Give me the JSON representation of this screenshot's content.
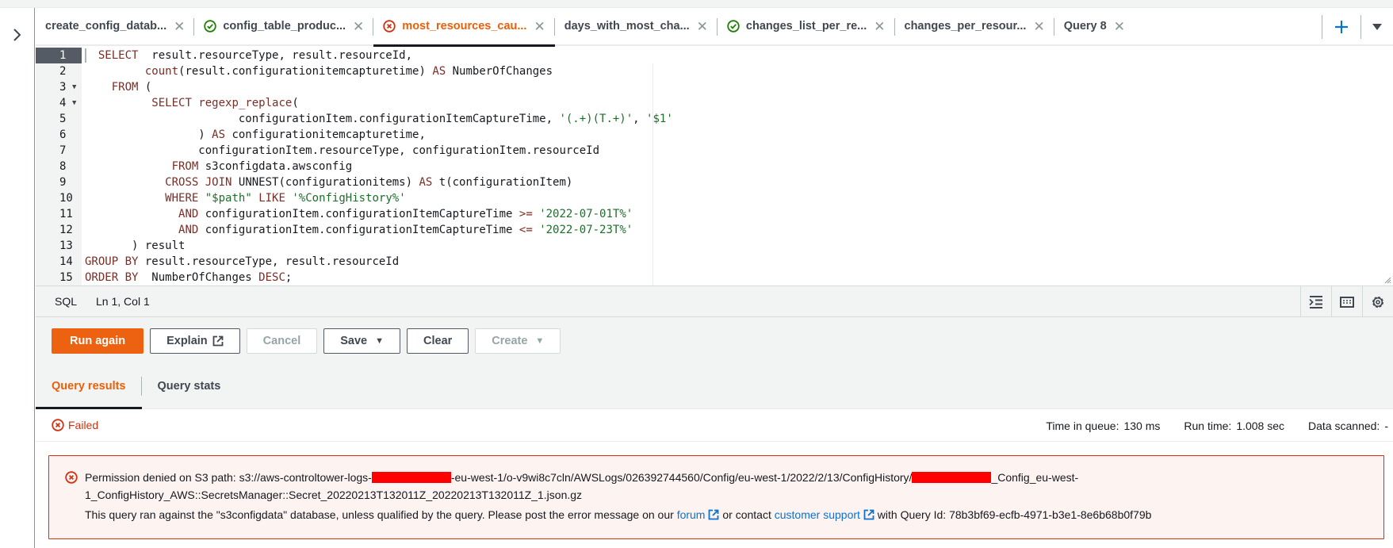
{
  "tabs": [
    {
      "label": "create_config_datab...",
      "status": "none",
      "active": false
    },
    {
      "label": "config_table_produc...",
      "status": "success",
      "active": false
    },
    {
      "label": "most_resources_cau...",
      "status": "error",
      "active": true
    },
    {
      "label": "days_with_most_cha...",
      "status": "none",
      "active": false
    },
    {
      "label": "changes_list_per_re...",
      "status": "success",
      "active": false
    },
    {
      "label": "changes_per_resour...",
      "status": "none",
      "active": false
    },
    {
      "label": "Query 8",
      "status": "none",
      "active": false
    }
  ],
  "tab_actions": {
    "add_icon": "plus-icon",
    "menu_icon": "caret-down-icon"
  },
  "editor": {
    "lines": [
      {
        "n": "1",
        "fold": false,
        "tokens": [
          [
            "kw",
            "SELECT"
          ],
          [
            "t",
            "  result.resourceType, result.resourceId,"
          ]
        ],
        "indent": "  "
      },
      {
        "n": "2",
        "fold": false,
        "tokens": [
          [
            "kw",
            "count"
          ],
          [
            "t",
            "(result.configurationitemcapturetime) "
          ],
          [
            "kw",
            "AS"
          ],
          [
            "t",
            " NumberOfChanges"
          ]
        ],
        "indent": "         "
      },
      {
        "n": "3",
        "fold": true,
        "tokens": [
          [
            "kw",
            "FROM"
          ],
          [
            "t",
            " ("
          ]
        ],
        "indent": "    "
      },
      {
        "n": "4",
        "fold": true,
        "tokens": [
          [
            "kw",
            "SELECT"
          ],
          [
            "t",
            " "
          ],
          [
            "kw",
            "regexp_replace"
          ],
          [
            "t",
            "("
          ]
        ],
        "indent": "          "
      },
      {
        "n": "5",
        "fold": false,
        "tokens": [
          [
            "t",
            "configurationItem.configurationItemCaptureTime, "
          ],
          [
            "str",
            "'(.+)(T.+)'"
          ],
          [
            "t",
            ", "
          ],
          [
            "str",
            "'$1'"
          ]
        ],
        "indent": "                       "
      },
      {
        "n": "6",
        "fold": false,
        "tokens": [
          [
            "t",
            ") "
          ],
          [
            "kw",
            "AS"
          ],
          [
            "t",
            " configurationitemcapturetime,"
          ]
        ],
        "indent": "                 "
      },
      {
        "n": "7",
        "fold": false,
        "tokens": [
          [
            "t",
            "configurationItem.resourceType, configurationItem.resourceId"
          ]
        ],
        "indent": "                 "
      },
      {
        "n": "8",
        "fold": false,
        "tokens": [
          [
            "kw",
            "FROM"
          ],
          [
            "t",
            " s3configdata.awsconfig"
          ]
        ],
        "indent": "             "
      },
      {
        "n": "9",
        "fold": false,
        "tokens": [
          [
            "kw",
            "CROSS"
          ],
          [
            "t",
            " "
          ],
          [
            "kw",
            "JOIN"
          ],
          [
            "t",
            " UNNEST(configurationitems) "
          ],
          [
            "kw",
            "AS"
          ],
          [
            "t",
            " t(configurationItem)"
          ]
        ],
        "indent": "            "
      },
      {
        "n": "10",
        "fold": false,
        "tokens": [
          [
            "kw",
            "WHERE"
          ],
          [
            "t",
            " "
          ],
          [
            "str",
            "\"$path\""
          ],
          [
            "t",
            " "
          ],
          [
            "kw",
            "LIKE"
          ],
          [
            "t",
            " "
          ],
          [
            "str",
            "'%ConfigHistory%'"
          ]
        ],
        "indent": "            "
      },
      {
        "n": "11",
        "fold": false,
        "tokens": [
          [
            "kw",
            "AND"
          ],
          [
            "t",
            " configurationItem.configurationItemCaptureTime "
          ],
          [
            "kw",
            ">="
          ],
          [
            "t",
            " "
          ],
          [
            "str",
            "'2022-07-01T%'"
          ]
        ],
        "indent": "              "
      },
      {
        "n": "12",
        "fold": false,
        "tokens": [
          [
            "kw",
            "AND"
          ],
          [
            "t",
            " configurationItem.configurationItemCaptureTime "
          ],
          [
            "kw",
            "<="
          ],
          [
            "t",
            " "
          ],
          [
            "str",
            "'2022-07-23T%'"
          ]
        ],
        "indent": "              "
      },
      {
        "n": "13",
        "fold": false,
        "tokens": [
          [
            "t",
            ") result"
          ]
        ],
        "indent": "       "
      },
      {
        "n": "14",
        "fold": false,
        "tokens": [
          [
            "kw",
            "GROUP BY"
          ],
          [
            "t",
            " result.resourceType, result.resourceId"
          ]
        ],
        "indent": ""
      },
      {
        "n": "15",
        "fold": false,
        "tokens": [
          [
            "kw",
            "ORDER BY"
          ],
          [
            "t",
            "  NumberOfChanges "
          ],
          [
            "kw",
            "DESC"
          ],
          [
            "t",
            ";"
          ]
        ],
        "indent": ""
      }
    ]
  },
  "statusbar": {
    "language": "SQL",
    "position": "Ln 1, Col 1"
  },
  "actions": {
    "run_again": "Run again",
    "explain": "Explain",
    "cancel": "Cancel",
    "save": "Save",
    "clear": "Clear",
    "create": "Create"
  },
  "results": {
    "tabs": [
      "Query results",
      "Query stats"
    ],
    "status": "Failed",
    "metrics": {
      "time_in_queue_label": "Time in queue:",
      "time_in_queue": "130 ms",
      "run_time_label": "Run time:",
      "run_time": "1.008 sec",
      "data_scanned_label": "Data scanned:",
      "data_scanned": "-"
    }
  },
  "error": {
    "line1_prefix": "Permission denied on S3 path: s3://aws-controltower-logs-",
    "line1_mid": "-eu-west-1/o-v9wi8c7cln/AWSLogs/026392744560/Config/eu-west-1/2022/2/13/ConfigHistory/",
    "line1_suffix": "_Config_eu-west-",
    "line2": "1_ConfigHistory_AWS::SecretsManager::Secret_20220213T132011Z_20220213T132011Z_1.json.gz",
    "line3_prefix": "This query ran against the \"s3configdata\" database, unless qualified by the query. Please post the error message on our ",
    "forum_link": "forum",
    "line3_mid": " or contact ",
    "support_link": "customer support",
    "line3_suffix": " with Query Id: 78b3bf69-ecfb-4971-b3e1-8e6b68b0f79b"
  },
  "colors": {
    "accent": "#ec6211",
    "error": "#d13212",
    "success": "#1d8102",
    "link": "#0972d3"
  }
}
